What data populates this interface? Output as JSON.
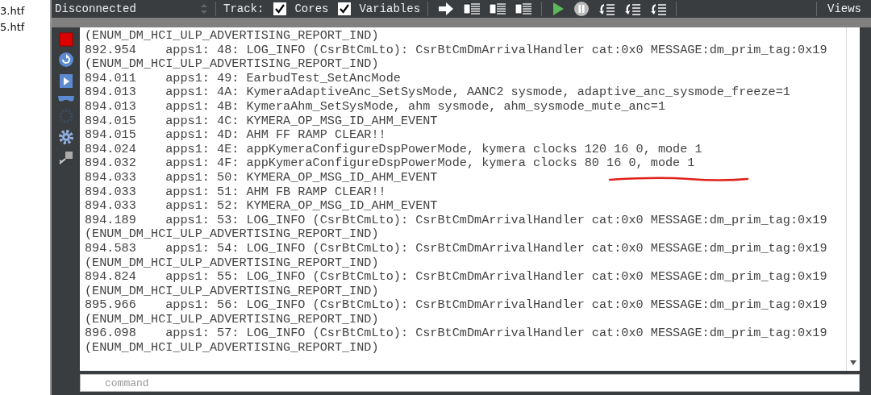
{
  "file_list": [
    "3.htf",
    "5.htf"
  ],
  "toolbar": {
    "connection": "Disconnected",
    "track_label": "Track:",
    "options": [
      {
        "label": "Cores",
        "checked": true
      },
      {
        "label": "Variables",
        "checked": true
      }
    ],
    "views": "Views"
  },
  "log": [
    {
      "kind": "continuation",
      "text": "(ENUM_DM_HCI_ULP_ADVERTISING_REPORT_IND)"
    },
    {
      "kind": "entry",
      "time": "892.954",
      "text": "apps1: 48: LOG_INFO (CsrBtCmLto): CsrBtCmDmArrivalHandler cat:0x0 MESSAGE:dm_prim_tag:0x19"
    },
    {
      "kind": "continuation",
      "text": "(ENUM_DM_HCI_ULP_ADVERTISING_REPORT_IND)"
    },
    {
      "kind": "entry",
      "time": "894.011",
      "text": "apps1: 49: EarbudTest_SetAncMode"
    },
    {
      "kind": "entry",
      "time": "894.013",
      "text": "apps1: 4A: KymeraAdaptiveAnc_SetSysMode, AANC2 sysmode, adaptive_anc_sysmode_freeze=1"
    },
    {
      "kind": "entry",
      "time": "894.013",
      "text": "apps1: 4B: KymeraAhm_SetSysMode, ahm sysmode, ahm_sysmode_mute_anc=1"
    },
    {
      "kind": "entry",
      "time": "894.015",
      "text": "apps1: 4C: KYMERA_OP_MSG_ID_AHM_EVENT"
    },
    {
      "kind": "entry",
      "time": "894.015",
      "text": "apps1: 4D: AHM FF RAMP CLEAR!!"
    },
    {
      "kind": "entry",
      "time": "894.024",
      "text": "apps1: 4E: appKymeraConfigureDspPowerMode, kymera clocks 120 16 0, mode 1"
    },
    {
      "kind": "entry",
      "time": "894.032",
      "text": "apps1: 4F: appKymeraConfigureDspPowerMode, kymera clocks 80 16 0, mode 1"
    },
    {
      "kind": "entry",
      "time": "894.033",
      "text": "apps1: 50: KYMERA_OP_MSG_ID_AHM_EVENT"
    },
    {
      "kind": "entry",
      "time": "894.033",
      "text": "apps1: 51: AHM FB RAMP CLEAR!!"
    },
    {
      "kind": "entry",
      "time": "894.033",
      "text": "apps1: 52: KYMERA_OP_MSG_ID_AHM_EVENT"
    },
    {
      "kind": "entry",
      "time": "894.189",
      "text": "apps1: 53: LOG_INFO (CsrBtCmLto): CsrBtCmDmArrivalHandler cat:0x0 MESSAGE:dm_prim_tag:0x19"
    },
    {
      "kind": "continuation",
      "text": "(ENUM_DM_HCI_ULP_ADVERTISING_REPORT_IND)"
    },
    {
      "kind": "entry",
      "time": "894.583",
      "text": "apps1: 54: LOG_INFO (CsrBtCmLto): CsrBtCmDmArrivalHandler cat:0x0 MESSAGE:dm_prim_tag:0x19"
    },
    {
      "kind": "continuation",
      "text": "(ENUM_DM_HCI_ULP_ADVERTISING_REPORT_IND)"
    },
    {
      "kind": "entry",
      "time": "894.824",
      "text": "apps1: 55: LOG_INFO (CsrBtCmLto): CsrBtCmDmArrivalHandler cat:0x0 MESSAGE:dm_prim_tag:0x19"
    },
    {
      "kind": "continuation",
      "text": "(ENUM_DM_HCI_ULP_ADVERTISING_REPORT_IND)"
    },
    {
      "kind": "entry",
      "time": "895.966",
      "text": "apps1: 56: LOG_INFO (CsrBtCmLto): CsrBtCmDmArrivalHandler cat:0x0 MESSAGE:dm_prim_tag:0x19"
    },
    {
      "kind": "continuation",
      "text": "(ENUM_DM_HCI_ULP_ADVERTISING_REPORT_IND)"
    },
    {
      "kind": "entry",
      "time": "896.098",
      "text": "apps1: 57: LOG_INFO (CsrBtCmLto): CsrBtCmDmArrivalHandler cat:0x0 MESSAGE:dm_prim_tag:0x19"
    },
    {
      "kind": "continuation",
      "text": "(ENUM_DM_HCI_ULP_ADVERTISING_REPORT_IND)"
    }
  ],
  "command": {
    "placeholder": "command"
  }
}
